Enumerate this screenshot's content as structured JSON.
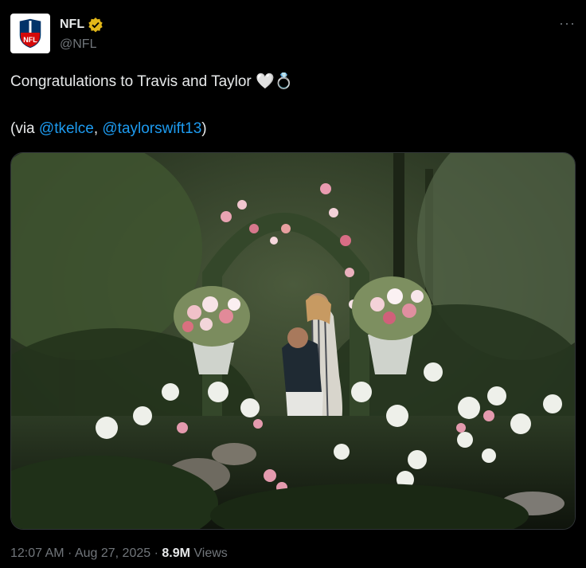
{
  "author": {
    "name": "NFL",
    "handle": "@NFL",
    "verified_icon": "gold-verified-badge",
    "avatar_text": "NFL"
  },
  "more_icon": "ellipsis-icon",
  "tweet": {
    "line1_text": "Congratulations to Travis and Taylor",
    "emoji_heart": "🤍",
    "emoji_ring": "💍",
    "line2_prefix": "(via ",
    "mention1": "@tkelce",
    "sep": ", ",
    "mention2": "@taylorswift13",
    "line2_suffix": ")"
  },
  "media": {
    "type": "photo",
    "icon": "photo-garden-proposal"
  },
  "meta": {
    "time": "12:07 AM",
    "dot1": " · ",
    "date": "Aug 27, 2025",
    "dot2": " · ",
    "views_count": "8.9M",
    "views_label": " Views"
  },
  "colors": {
    "background": "#000000",
    "text": "#e7e9ea",
    "secondary": "#71767b",
    "link": "#1d9bf0",
    "verified": "#e2b719"
  }
}
